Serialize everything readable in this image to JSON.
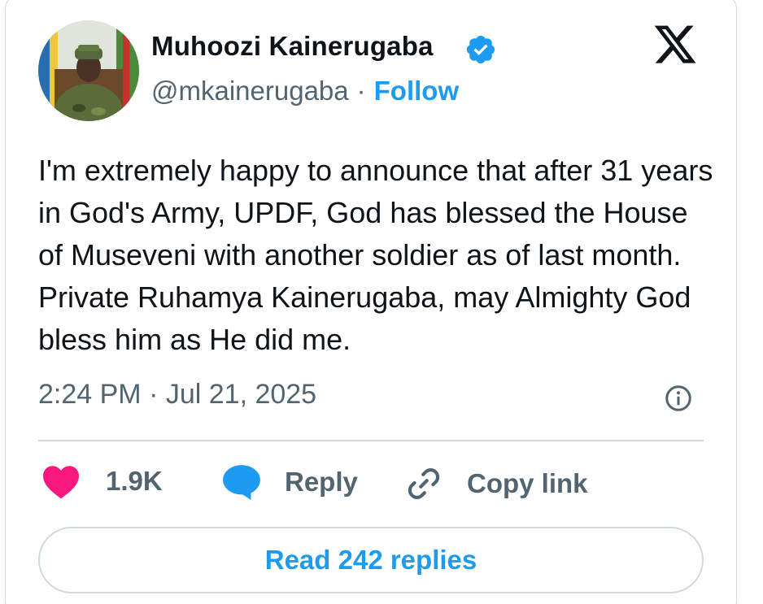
{
  "author": {
    "display_name": "Muhoozi Kainerugaba",
    "handle": "@mkainerugaba",
    "separator": "·",
    "follow_label": "Follow",
    "verified": true
  },
  "tweet": {
    "text": "I'm extremely happy to announce that after 31 years in God's Army, UPDF, God has blessed the House of Museveni with another soldier as of last month. Private Ruhamya Kainerugaba, may Almighty God bless him as He did me.",
    "timestamp": "2:24 PM · Jul 21, 2025"
  },
  "actions": {
    "likes": "1.9K",
    "reply_label": "Reply",
    "copy_link_label": "Copy link"
  },
  "read_replies_label": "Read 242 replies",
  "icons": {
    "brand": "x-logo-icon",
    "verified": "verified-badge-icon",
    "info": "info-icon",
    "like": "heart-icon",
    "reply": "speech-bubble-icon",
    "copy": "link-icon"
  },
  "colors": {
    "accent": "#1d9bf0",
    "like": "#f91880",
    "muted": "#536471",
    "text": "#0f1419",
    "border": "#cfd9de"
  }
}
